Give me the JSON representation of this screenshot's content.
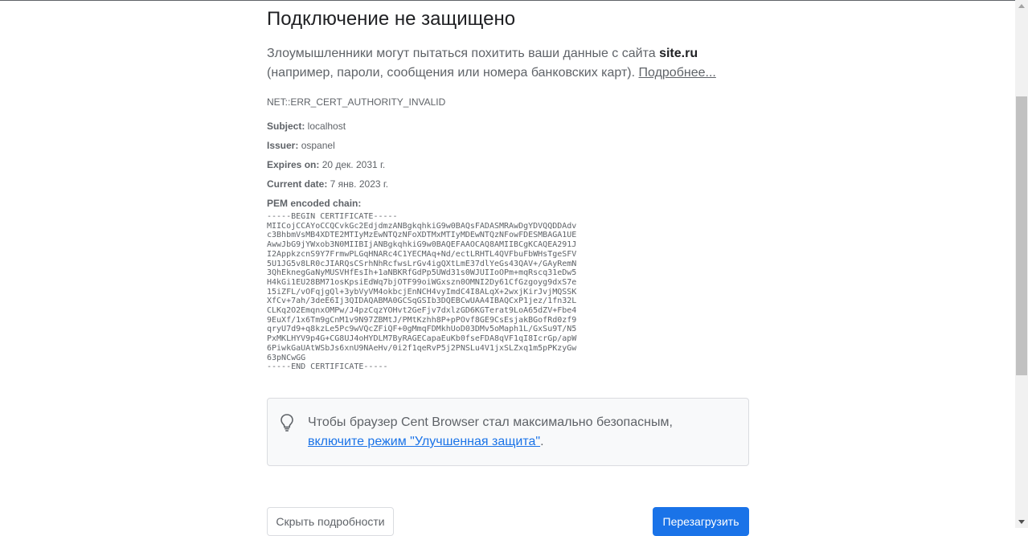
{
  "heading": "Подключение не защищено",
  "message": {
    "before": "Злоумышленники могут пытаться похитить ваши данные с сайта ",
    "site": "site.ru",
    "after": " (например, пароли, сообщения или номера банковских карт). ",
    "link": "Подробнее..."
  },
  "error_code": "NET::ERR_CERT_AUTHORITY_INVALID",
  "details": {
    "subject_label": "Subject:",
    "subject_value": " localhost",
    "issuer_label": "Issuer:",
    "issuer_value": " ospanel",
    "expires_label": "Expires on:",
    "expires_value": " 20 дек. 2031 г.",
    "current_label": "Current date:",
    "current_value": " 7 янв. 2023 г.",
    "pem_label": "PEM encoded chain:"
  },
  "pem": "-----BEGIN CERTIFICATE-----\nMIICojCCAYoCCQCvkGc2EdjdmzANBgkqhkiG9w0BAQsFADASMRAwDgYDVQQDDAdv\nc3BhbmVsMB4XDTE2MTIyMzEwNTQzNFoXDTMxMTIyMDEwNTQzNFowFDESMBAGA1UE\nAwwJbG9jYWxob3N0MIIBIjANBgkqhkiG9w0BAQEFAAOCAQ8AMIIBCgKCAQEA291J\nI2AppkzcnS9Y7FrmwPLGqHNARc4C1YECMAq+Nd/ectLRHTL4QVFbuFbWHsTgeSFV\n5U1JG5v8LR0cJIARQsCSrhNhRcfwsLrGv4igQXtLmE37dlYeGs43QAV+/GAyRemN\n3QhEknegGaNyMUSVHfEsIh+1aNBKRfGdPp5UWd31s0WJUIIoOPm+mqRscq31eDw5\nH4kGi1EU28BM71osKpsiEdWq7bjOTF99oiWGxszn0OMNI2Dy61CfGzgoyg9dxS7e\n15iZFL/vOFqjgQl+3ybVyVM4okbcjEnNCH4vyImdC4I8ALqX+2wxjKirJvjMQSSK\nXfCv+7ah/3deE6Ij3QIDAQABMA0GCSqGSIb3DQEBCwUAA4IBAQCxP1jez/1fn32L\nCLKq2O2EmqnxOMPw/J4pzCqzYOHvt2GeFjv7dxlzGD6KGTerat9LoA65dZV+Fbe4\n9EuXf/1x6Tm9gCnM1v9N97ZBMtJ/PMtKzhh8P+pPOvf8GE9CsEsjakBGofRd0zf9\nqryU7d9+q8kzLe5Pc9wVQcZFiQF+0gMmqFDMkhUoD03DMv5oMaph1L/GxSu9T/N5\nPxMKLHYV9p4G+CG8UJ4oHYDLM7ByRAGECapaEuKb0fseFDA8qVF1qI8IcrGp/apW\n6PiwkGaUAtWSbJs6xnU9NAeHv/0i2f1qeRvP5j2PNSLu4V1jxSLZxq1m5pPKzyGw\n63pNCwGG\n-----END CERTIFICATE-----",
  "tip": {
    "text": "Чтобы браузер Cent Browser стал максимально безопасным, ",
    "link": "включите режим \"Улучшенная защита\"",
    "end": "."
  },
  "buttons": {
    "hide_details": "Скрыть подробности",
    "reload": "Перезагрузить"
  },
  "colors": {
    "primary": "#1a73e8",
    "text": "#202124",
    "secondary_text": "#5f6368"
  },
  "icons": [
    "lightbulb-icon"
  ]
}
